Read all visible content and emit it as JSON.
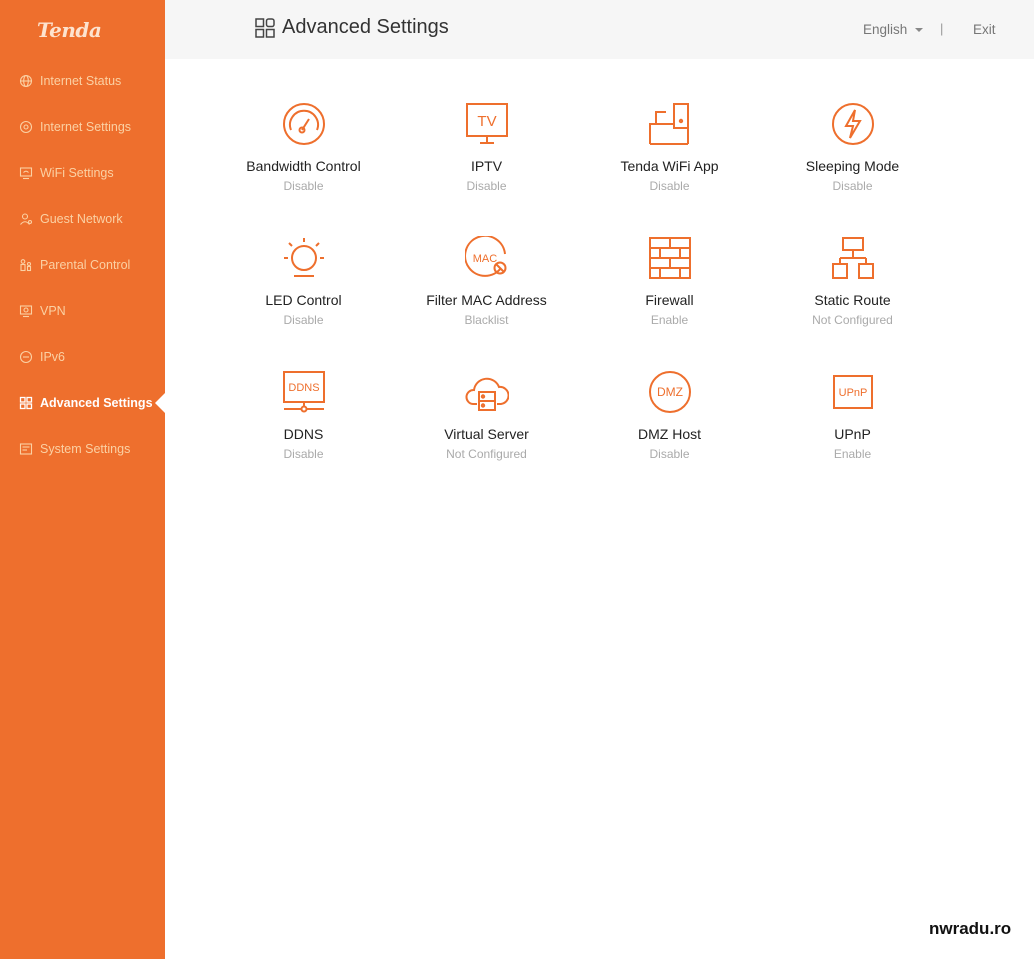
{
  "brand": {
    "logo_text": "Tenda",
    "accent": "#ee6f2d"
  },
  "sidebar": {
    "items": [
      {
        "label": "Internet Status",
        "icon": "globe-icon",
        "active": false
      },
      {
        "label": "Internet Settings",
        "icon": "settings-circle-icon",
        "active": false
      },
      {
        "label": "WiFi Settings",
        "icon": "wifi-monitor-icon",
        "active": false
      },
      {
        "label": "Guest Network",
        "icon": "guest-user-icon",
        "active": false
      },
      {
        "label": "Parental Control",
        "icon": "parental-icon",
        "active": false
      },
      {
        "label": "VPN",
        "icon": "vpn-icon",
        "active": false
      },
      {
        "label": "IPv6",
        "icon": "ipv6-icon",
        "active": false
      },
      {
        "label": "Advanced Settings",
        "icon": "grid-icon",
        "active": true
      },
      {
        "label": "System Settings",
        "icon": "system-icon",
        "active": false
      }
    ]
  },
  "header": {
    "title": "Advanced Settings",
    "language": "English",
    "separator": "|",
    "exit_label": "Exit"
  },
  "tiles": [
    {
      "name": "Bandwidth Control",
      "status": "Disable",
      "icon": "gauge-icon"
    },
    {
      "name": "IPTV",
      "status": "Disable",
      "icon": "tv-icon"
    },
    {
      "name": "Tenda WiFi App",
      "status": "Disable",
      "icon": "phone-app-icon"
    },
    {
      "name": "Sleeping Mode",
      "status": "Disable",
      "icon": "lightning-icon"
    },
    {
      "name": "LED Control",
      "status": "Disable",
      "icon": "bulb-icon"
    },
    {
      "name": "Filter MAC Address",
      "status": "Blacklist",
      "icon": "mac-filter-icon"
    },
    {
      "name": "Firewall",
      "status": "Enable",
      "icon": "firewall-icon"
    },
    {
      "name": "Static Route",
      "status": "Not Configured",
      "icon": "route-icon"
    },
    {
      "name": "DDNS",
      "status": "Disable",
      "icon": "ddns-icon"
    },
    {
      "name": "Virtual Server",
      "status": "Not Configured",
      "icon": "cloud-server-icon"
    },
    {
      "name": "DMZ Host",
      "status": "Disable",
      "icon": "dmz-icon"
    },
    {
      "name": "UPnP",
      "status": "Enable",
      "icon": "upnp-icon"
    }
  ],
  "icon_text": {
    "tv": "TV",
    "mac": "MAC",
    "ddns": "DDNS",
    "dmz": "DMZ",
    "upnp": "UPnP"
  },
  "watermark": "nwradu.ro"
}
